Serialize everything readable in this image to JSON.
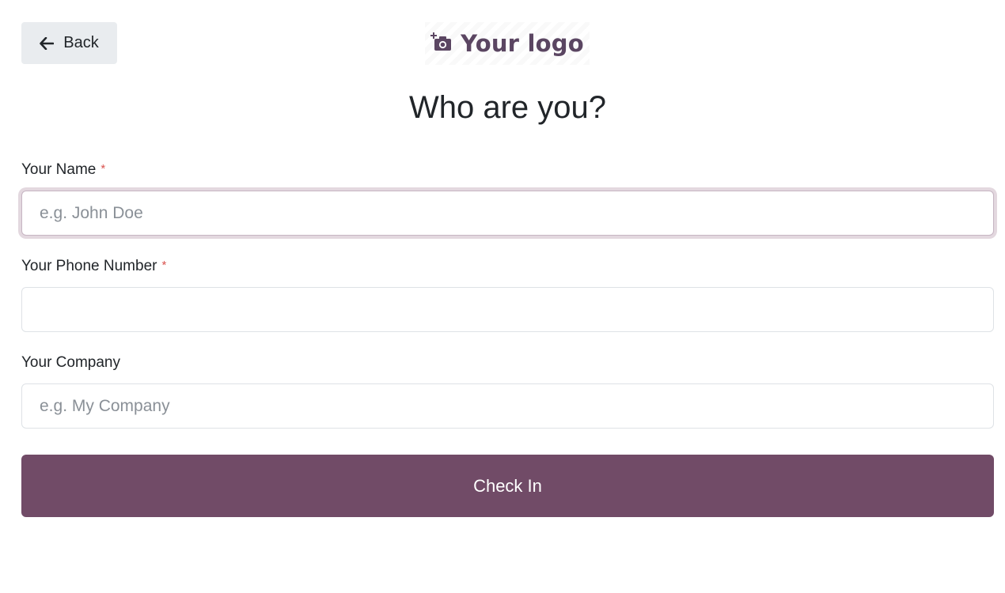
{
  "header": {
    "back_label": "Back",
    "logo_text": "Your logo"
  },
  "page_title": "Who are you?",
  "form": {
    "name": {
      "label": "Your Name",
      "required": "*",
      "value": "",
      "placeholder": "e.g. John Doe"
    },
    "phone": {
      "label": "Your Phone Number",
      "required": "*",
      "value": "",
      "placeholder": ""
    },
    "company": {
      "label": "Your Company",
      "value": "",
      "placeholder": "e.g. My Company"
    }
  },
  "submit_label": "Check In",
  "colors": {
    "brand": "#714b67",
    "logo": "#5b4662",
    "required": "#d9534f",
    "back_button_bg": "#e9ecef"
  },
  "icons": {
    "back": "arrow-left-icon",
    "logo": "camera-plus-icon"
  }
}
